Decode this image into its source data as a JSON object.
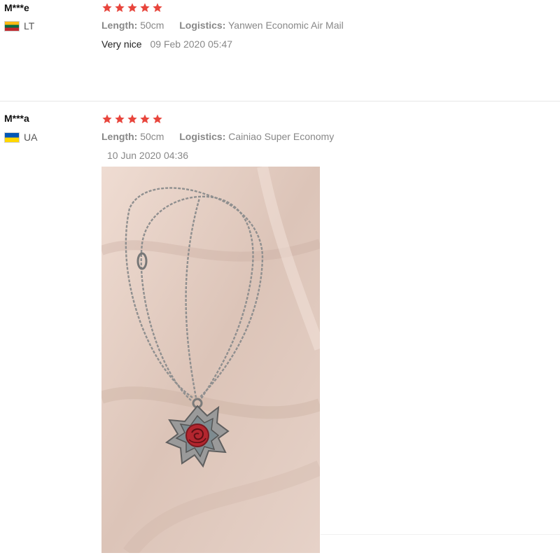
{
  "colors": {
    "star": "#e8453c",
    "text": "#222222",
    "muted": "#888888",
    "divider": "#e6e6e6"
  },
  "reviews": [
    {
      "user": "M***e",
      "country": "LT",
      "flag_icon": "lithuania-flag-icon",
      "rating": 5,
      "length_label": "Length:",
      "length_value": "50cm",
      "logistics_label": "Logistics:",
      "logistics_value": "Yanwen Economic Air Mail",
      "comment": "Very nice",
      "date": "09 Feb 2020 05:47"
    },
    {
      "user": "M***a",
      "country": "UA",
      "flag_icon": "ukraine-flag-icon",
      "rating": 5,
      "length_label": "Length:",
      "length_value": "50cm",
      "logistics_label": "Logistics:",
      "logistics_value": "Cainiao Super Economy",
      "comment": "",
      "date": "10 Jun 2020 04:36",
      "photo_icon": "necklace-photo"
    }
  ]
}
